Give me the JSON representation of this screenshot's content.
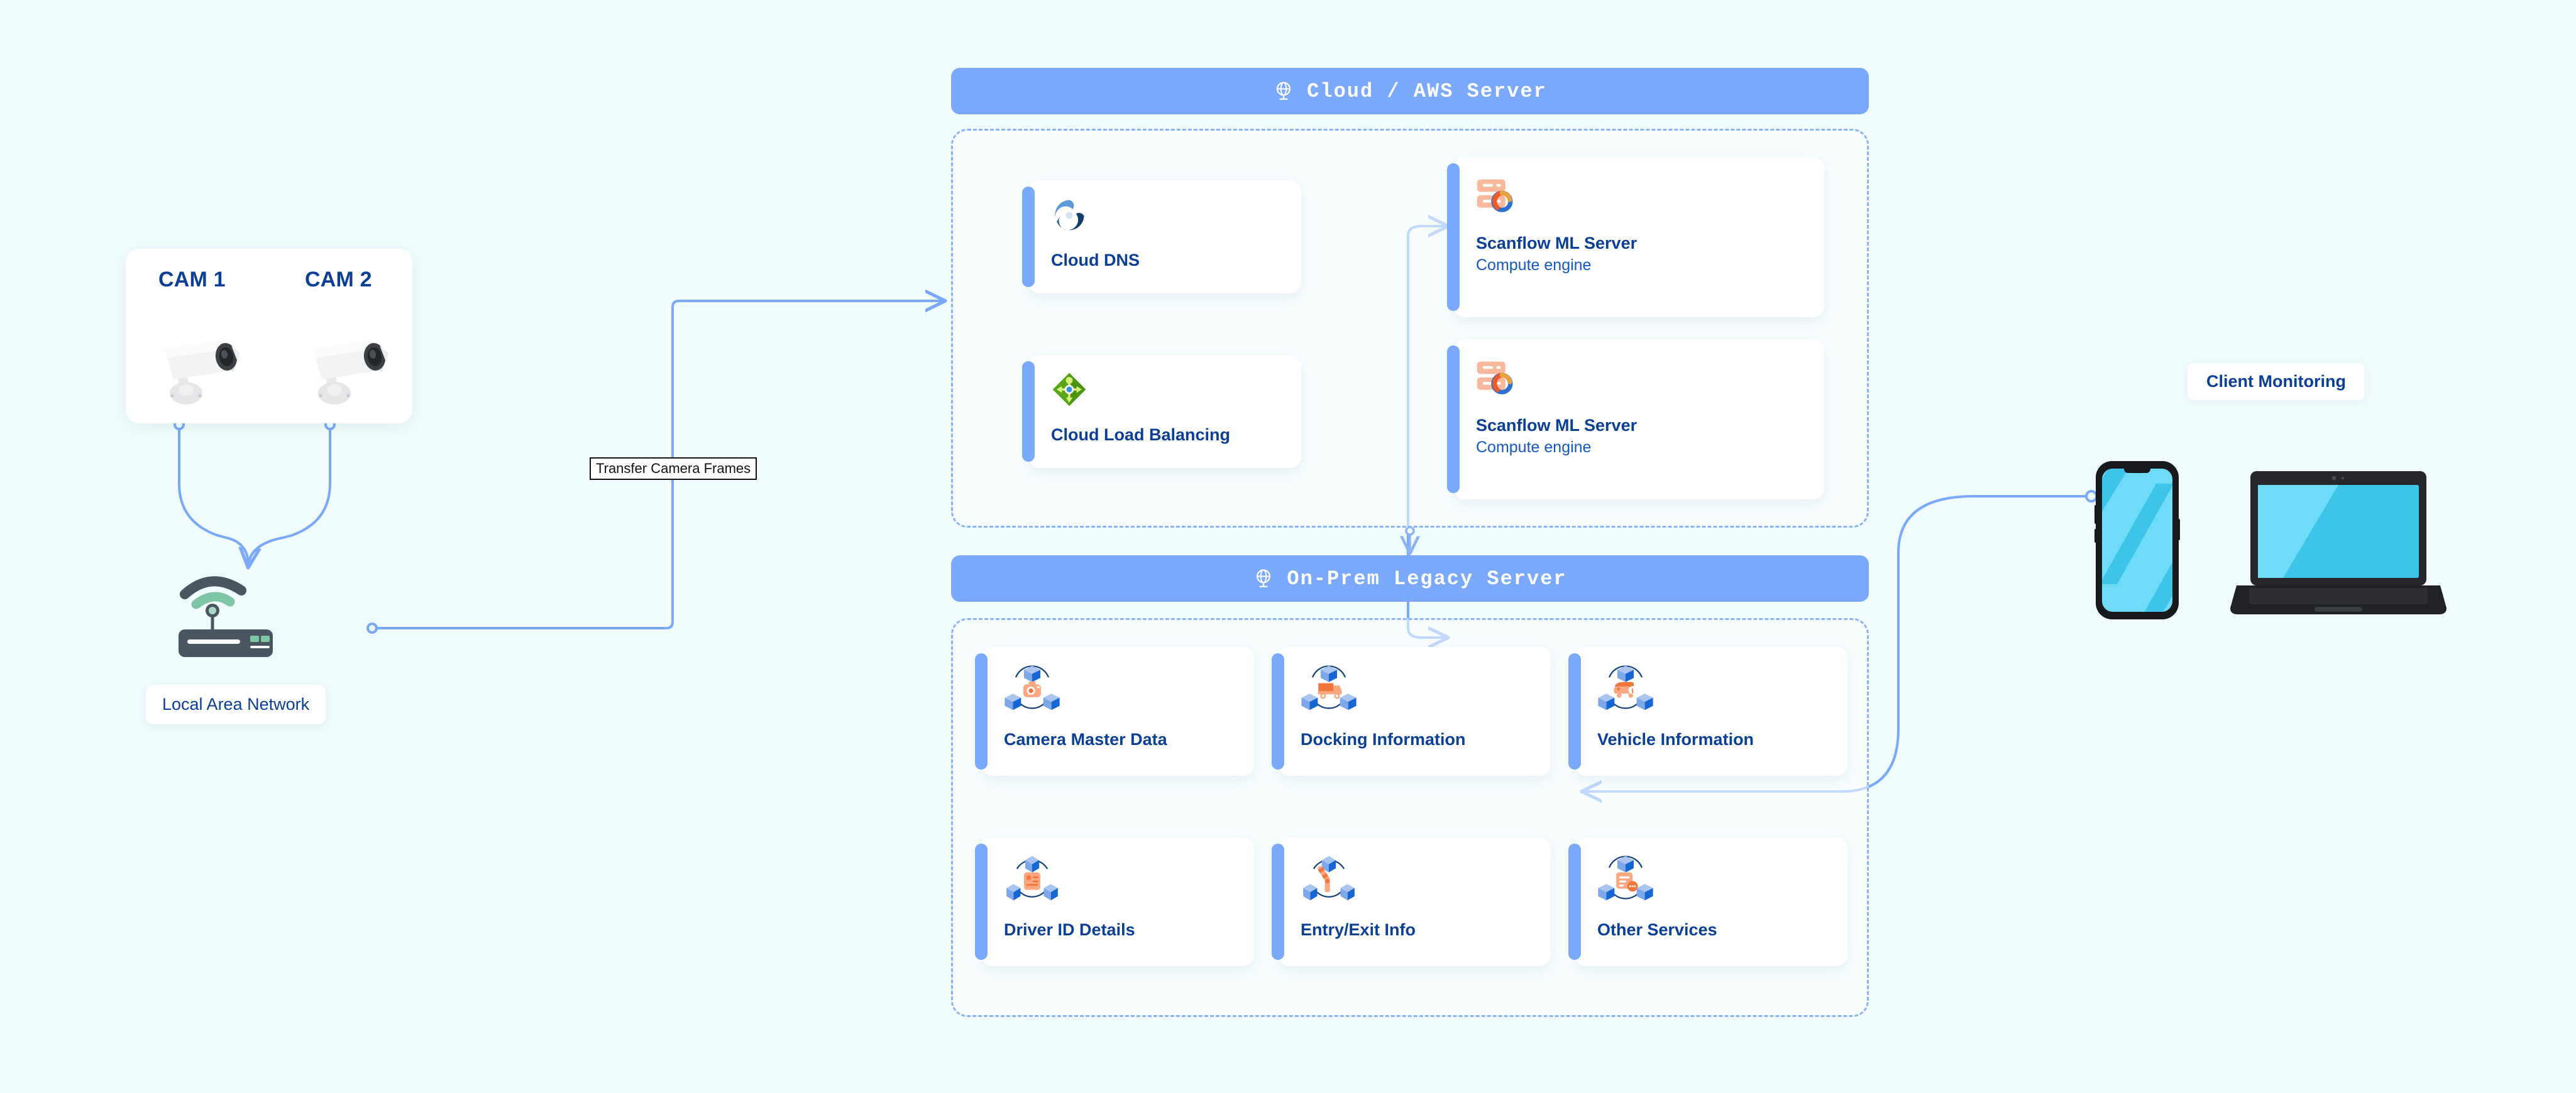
{
  "background_color": "#f0fcfd",
  "accent_color": "#7aa9fb",
  "title_color": "#0b3f96",
  "cameras": {
    "cam1_label": "CAM 1",
    "cam2_label": "CAM 2",
    "icon": "cctv-camera-icon"
  },
  "network": {
    "router_icon": "wifi-router-icon",
    "lan_label": "Local Area Network"
  },
  "edges": {
    "transfer_label": "Transfer Camera Frames"
  },
  "cloud_zone": {
    "header": "Cloud / AWS Server",
    "header_icon": "globe-icon",
    "cards": [
      {
        "title": "Cloud DNS",
        "subtitle": "",
        "icon": "cloud-dns-swirl-icon"
      },
      {
        "title": "Cloud Load Balancing",
        "subtitle": "",
        "icon": "load-balancer-diamond-icon"
      },
      {
        "title": "Scanflow ML Server",
        "subtitle": "Compute engine",
        "icon": "server-rack-icon"
      },
      {
        "title": "Scanflow ML Server",
        "subtitle": "Compute engine",
        "icon": "server-rack-icon"
      }
    ]
  },
  "onprem_zone": {
    "header": "On-Prem Legacy Server",
    "header_icon": "globe-icon",
    "cards": [
      {
        "title": "Camera Master Data",
        "icon": "cubes-camera-icon"
      },
      {
        "title": "Docking Information",
        "icon": "cubes-truck-icon"
      },
      {
        "title": "Vehicle Information",
        "icon": "cubes-vehicle-info-icon"
      },
      {
        "title": "Driver ID Details",
        "icon": "cubes-id-card-icon"
      },
      {
        "title": "Entry/Exit Info",
        "icon": "cubes-barrier-gate-icon"
      },
      {
        "title": "Other Services",
        "icon": "cubes-document-chat-icon"
      }
    ]
  },
  "client": {
    "label": "Client Monitoring",
    "devices": [
      {
        "name": "smartphone-icon"
      },
      {
        "name": "laptop-icon"
      }
    ]
  }
}
